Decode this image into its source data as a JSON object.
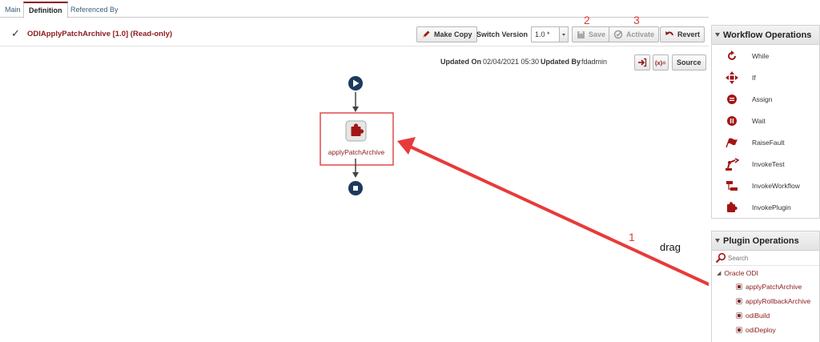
{
  "tabs": [
    {
      "label": "Main"
    },
    {
      "label": "Definition"
    },
    {
      "label": "Referenced By"
    }
  ],
  "header": {
    "title": "ODIApplyPatchArchive [1.0] (Read-only)",
    "make_copy": "Make Copy",
    "switch_version_label": "Switch Version",
    "version_value": "1.0 *",
    "save": "Save",
    "activate": "Activate",
    "revert": "Revert"
  },
  "meta": {
    "updated_on_label": "Updated On",
    "updated_on_value": "02/04/2021 05:30",
    "updated_by_label": "Updated By",
    "updated_by_value": "fdadmin",
    "variables_icon": "(x)=",
    "source_button": "Source"
  },
  "canvas": {
    "node_label": "applyPatchArchive"
  },
  "annotations": {
    "step1": "1",
    "step2": "2",
    "step3": "3",
    "drag": "drag"
  },
  "workflow_ops": {
    "title": "Workflow Operations",
    "items": [
      {
        "label": "While",
        "icon": "loop-icon"
      },
      {
        "label": "If",
        "icon": "branch-icon"
      },
      {
        "label": "Assign",
        "icon": "assign-icon"
      },
      {
        "label": "Wait",
        "icon": "pause-icon"
      },
      {
        "label": "RaiseFault",
        "icon": "flag-icon"
      },
      {
        "label": "InvokeTest",
        "icon": "robot-arm-icon"
      },
      {
        "label": "InvokeWorkflow",
        "icon": "workflow-icon"
      },
      {
        "label": "InvokePlugin",
        "icon": "puzzle-icon"
      }
    ]
  },
  "plugin_ops": {
    "title": "Plugin Operations",
    "search_placeholder": "Search",
    "group": "Oracle ODI",
    "items": [
      {
        "label": "applyPatchArchive"
      },
      {
        "label": "applyRollbackArchive"
      },
      {
        "label": "odiBuild"
      },
      {
        "label": "odiDeploy"
      }
    ]
  },
  "colors": {
    "accent": "#8b1a1a",
    "node_dark": "#1c3a5e",
    "annotation": "#e03a3a"
  }
}
